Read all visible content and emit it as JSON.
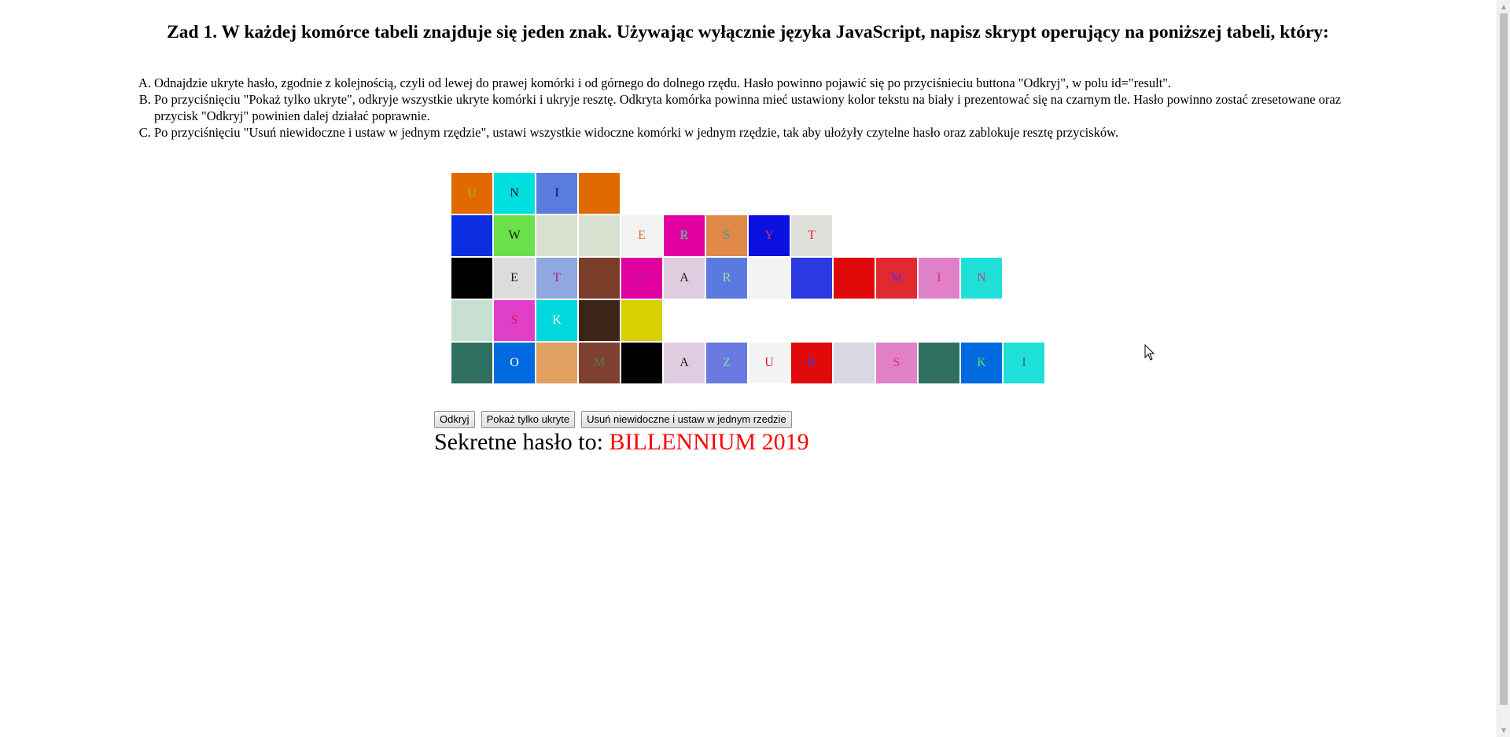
{
  "heading": "Zad 1. W każdej komórce tabeli znajduje się jeden znak. Używając wyłącznie języka JavaScript, napisz skrypt operujący na poniższej tabeli, który:",
  "instructions": [
    "Odnajdzie ukryte hasło, zgodnie z kolejnością, czyli od lewej do prawej komórki i od górnego do dolnego rzędu. Hasło powinno pojawić się po przyciśnieciu buttona \"Odkryj\", w polu id=\"result\".",
    "Po przyciśnięciu \"Pokaż tylko ukryte\", odkryje wszystkie ukryte komórki i ukryje resztę. Odkryta komórka powinna mieć ustawiony kolor tekstu na biały i prezentować się na czarnym tle. Hasło powinno zostać zresetowane oraz przycisk \"Odkryj\" powinien dalej działać poprawnie.",
    "Po przyciśnięciu \"Usuń niewidoczne i ustaw w jednym rzędzie\", ustawi wszystkie widoczne komórki w jednym rzędzie, tak aby ułożyły czytelne hasło oraz zablokuje resztę przycisków."
  ],
  "table": {
    "rows": [
      [
        {
          "ch": "U",
          "bg": "#e06a00",
          "fg": "#8bd000"
        },
        {
          "ch": "N",
          "bg": "#00dede",
          "fg": "#1a1a1a"
        },
        {
          "ch": "I",
          "bg": "#5a7be0",
          "fg": "#101020"
        },
        {
          "ch": "",
          "bg": "#e06a00",
          "fg": "#e06a00"
        }
      ],
      [
        {
          "ch": "",
          "bg": "#0a2ee0",
          "fg": "#0a2ee0"
        },
        {
          "ch": "W",
          "bg": "#6ae04a",
          "fg": "#1a1a1a"
        },
        {
          "ch": "",
          "bg": "#d8e0d0",
          "fg": "#d8e0d0"
        },
        {
          "ch": "",
          "bg": "#d8e0d0",
          "fg": "#d8e0d0"
        },
        {
          "ch": "E",
          "bg": "#f2f2f2",
          "fg": "#e07030"
        },
        {
          "ch": "R",
          "bg": "#e000a0",
          "fg": "#40e0a0"
        },
        {
          "ch": "S",
          "bg": "#e08848",
          "fg": "#30a090"
        },
        {
          "ch": "Y",
          "bg": "#0a10e0",
          "fg": "#e03060"
        },
        {
          "ch": "T",
          "bg": "#e0e0da",
          "fg": "#e02040"
        }
      ],
      [
        {
          "ch": "",
          "bg": "#000000",
          "fg": "#000000"
        },
        {
          "ch": "E",
          "bg": "#dcdcdc",
          "fg": "#1a1a1a"
        },
        {
          "ch": "T",
          "bg": "#90a8e0",
          "fg": "#c01060"
        },
        {
          "ch": "",
          "bg": "#7a3e2a",
          "fg": "#7a3e2a"
        },
        {
          "ch": "W",
          "bg": "#e000a0",
          "fg": "#b02080"
        },
        {
          "ch": "A",
          "bg": "#e0cce0",
          "fg": "#1a1a1a"
        },
        {
          "ch": "R",
          "bg": "#5a7ae0",
          "fg": "#a0e0a0"
        },
        {
          "ch": "",
          "bg": "#f2f2f2",
          "fg": "#f2f2f2"
        },
        {
          "ch": "",
          "bg": "#2a3ae0",
          "fg": "#2a3ae0"
        },
        {
          "ch": "",
          "bg": "#e00a0a",
          "fg": "#e00a0a"
        },
        {
          "ch": "M",
          "bg": "#e02a30",
          "fg": "#6030e0"
        },
        {
          "ch": "I",
          "bg": "#e080c8",
          "fg": "#e02a80"
        },
        {
          "ch": "N",
          "bg": "#1ee0d8",
          "fg": "#c04080"
        }
      ],
      [
        {
          "ch": "",
          "bg": "#c8e0d4",
          "fg": "#c8e0d4"
        },
        {
          "ch": "S",
          "bg": "#e040c8",
          "fg": "#e01060"
        },
        {
          "ch": "K",
          "bg": "#00d8e0",
          "fg": "#ffffff"
        },
        {
          "ch": "",
          "bg": "#3e2418",
          "fg": "#3e2418"
        },
        {
          "ch": "",
          "bg": "#d8d000",
          "fg": "#d8d000"
        }
      ],
      [
        {
          "ch": "",
          "bg": "#307060",
          "fg": "#307060"
        },
        {
          "ch": "O",
          "bg": "#006ae0",
          "fg": "#ffffff"
        },
        {
          "ch": "-",
          "bg": "#e0a060",
          "fg": "#c0a060"
        },
        {
          "ch": "M",
          "bg": "#804030",
          "fg": "#508050"
        },
        {
          "ch": "",
          "bg": "#000000",
          "fg": "#000000"
        },
        {
          "ch": "A",
          "bg": "#e0cce0",
          "fg": "#1a1a1a"
        },
        {
          "ch": "Z",
          "bg": "#6a7ae0",
          "fg": "#80e0a0"
        },
        {
          "ch": "U",
          "bg": "#f4f4f4",
          "fg": "#e02020"
        },
        {
          "ch": "R",
          "bg": "#e00a0a",
          "fg": "#4040e0"
        },
        {
          "ch": "",
          "bg": "#d8d8e2",
          "fg": "#d8d8e2"
        },
        {
          "ch": "S",
          "bg": "#e080c8",
          "fg": "#e02a60"
        },
        {
          "ch": "",
          "bg": "#307060",
          "fg": "#307060"
        },
        {
          "ch": "K",
          "bg": "#006ae0",
          "fg": "#60e060"
        },
        {
          "ch": "I",
          "bg": "#1ee0d8",
          "fg": "#307060"
        }
      ]
    ]
  },
  "buttons": {
    "reveal": "Odkryj",
    "show_hidden": "Pokaż tylko ukryte",
    "remove_invisible": "Usuń niewidoczne i ustaw w jednym rzedzie"
  },
  "result": {
    "prefix": "Sekretne hasło to: ",
    "value": "BILLENNIUM 2019"
  }
}
